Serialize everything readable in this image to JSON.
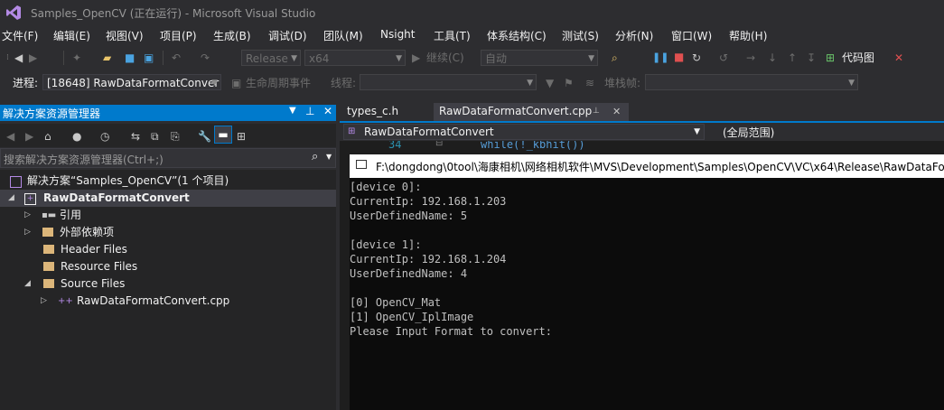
{
  "window": {
    "title": "Samples_OpenCV (正在运行) - Microsoft Visual Studio"
  },
  "menu": [
    "文件(F)",
    "编辑(E)",
    "视图(V)",
    "项目(P)",
    "生成(B)",
    "调试(D)",
    "团队(M)",
    "Nsight",
    "工具(T)",
    "体系结构(C)",
    "测试(S)",
    "分析(N)",
    "窗口(W)",
    "帮助(H)"
  ],
  "toolbar": {
    "config": "Release",
    "platform": "x64",
    "continue_label": "继续(C)",
    "auto": "自动",
    "code_map": "代码图"
  },
  "debugbar": {
    "process_label": "进程:",
    "process_value": "[18648] RawDataFormatConver",
    "lifecycle_label": "生命周期事件",
    "thread_label": "线程:",
    "stackframe_label": "堆栈帧:"
  },
  "solution_explorer": {
    "title": "解决方案资源管理器",
    "search_placeholder": "搜索解决方案资源管理器(Ctrl+;)",
    "tree": {
      "solution": "解决方案“Samples_OpenCV”(1 个项目)",
      "project": "RawDataFormatConvert",
      "references": "引用",
      "external": "外部依赖项",
      "header": "Header Files",
      "resource": "Resource Files",
      "source": "Source Files",
      "cpp": "RawDataFormatConvert.cpp"
    }
  },
  "editor": {
    "tabs": [
      "types_c.h",
      "RawDataFormatConvert.cpp"
    ],
    "nav_left": "RawDataFormatConvert",
    "nav_right": "(全局范围)",
    "line_number": "34",
    "code_snippet": "while(!_kbhit())"
  },
  "console": {
    "title": "F:\\dongdong\\0tool\\海康相机\\网络相机软件\\MVS\\Development\\Samples\\OpenCV\\VC\\x64\\Release\\RawDataFo",
    "lines": [
      "[device 0]:",
      "CurrentIp: 192.168.1.203",
      "UserDefinedName: 5",
      "",
      "[device 1]:",
      "CurrentIp: 192.168.1.204",
      "UserDefinedName: 4",
      "",
      "[0] OpenCV_Mat",
      "[1] OpenCV_IplImage",
      "Please Input Format to convert:"
    ]
  },
  "colors": {
    "accent": "#007acc",
    "background": "#2d2d30",
    "editor": "#1e1e1e",
    "console": "#0c0c0c"
  }
}
